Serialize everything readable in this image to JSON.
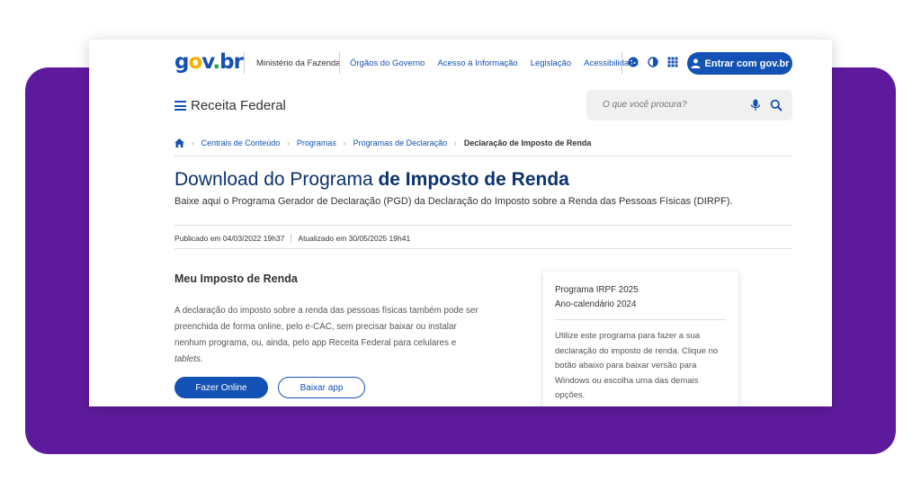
{
  "colors": {
    "background_panel": "#5e1a9c",
    "primary": "#1351b4",
    "title": "#0c326f"
  },
  "header": {
    "logo": {
      "g": "g",
      "o": "o",
      "v": "v",
      "dot": ".",
      "b": "b",
      "r": "r"
    },
    "ministry": "Ministério da Fazenda",
    "links": [
      "Órgãos do Governo",
      "Acesso à Informação",
      "Legislação",
      "Acessibilidade"
    ],
    "icons": [
      "cookie-icon",
      "contrast-icon",
      "apps-grid-icon"
    ],
    "login_label": "Entrar com gov.br"
  },
  "site": {
    "name": "Receita Federal",
    "search_placeholder": "O que você procura?"
  },
  "breadcrumb": {
    "items": [
      "Centrais de Conteúdo",
      "Programas",
      "Programas de Declaração"
    ],
    "current": "Declaração de Imposto de Renda"
  },
  "page": {
    "title_regular": "Download do Programa ",
    "title_bold": "de Imposto de Renda",
    "subtitle": "Baixe aqui o Programa Gerador de Declaração (PGD) da Declaração do Imposto sobre a Renda das Pessoas Físicas (DIRPF).",
    "published": "Publicado em 04/03/2022 19h37",
    "updated": "Atualizado em 30/05/2025 19h41"
  },
  "section": {
    "title": "Meu Imposto de Renda",
    "text": "A declaração do imposto sobre a renda das pessoas físicas também pode ser preenchida de forma online, pelo e-CAC, sem precisar baixar ou instalar nenhum programa, ou, ainda, pelo app Receita Federal para celulares e ",
    "text_em": "tablets",
    "text_end": ".",
    "btn_online": "Fazer Online",
    "btn_app": "Baixar app"
  },
  "side": {
    "line1": "Programa IRPF 2025",
    "line2": "Ano-calendário 2024",
    "text": "Utilize este programa para fazer a sua declaração do imposto de renda. Clique no botão abaixo para baixar versão para Windows ou escolha uma das demais opções."
  }
}
